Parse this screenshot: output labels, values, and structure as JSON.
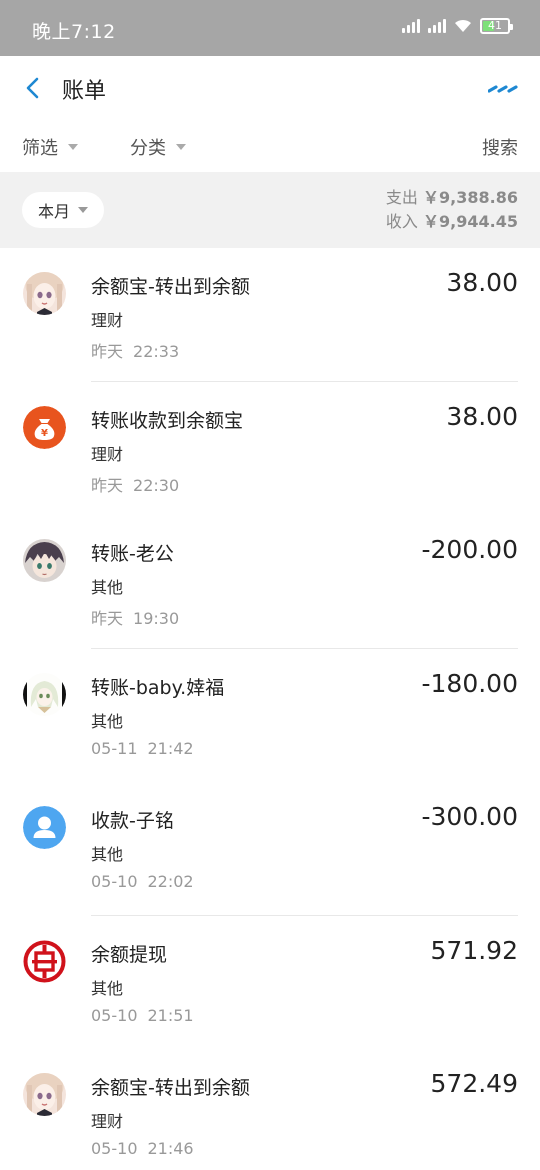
{
  "status_bar": {
    "time": "晚上7:12",
    "battery": "41"
  },
  "header": {
    "title": "账单"
  },
  "filters": {
    "screen": "筛选",
    "category": "分类",
    "search": "搜索"
  },
  "summary": {
    "month": "本月",
    "expense_label": "支出",
    "expense_amount": "￥9,388.86",
    "income_label": "收入",
    "income_amount": "￥9,944.45"
  },
  "transactions": [
    {
      "title": "余额宝-转出到余额",
      "category": "理财",
      "date": "昨天",
      "time": "22:33",
      "amount": "38.00",
      "avatar": "doll-avatar"
    },
    {
      "title": "转账收款到余额宝",
      "category": "理财",
      "date": "昨天",
      "time": "22:30",
      "amount": "38.00",
      "avatar": "money-bag-icon"
    },
    {
      "title": "转账-老公",
      "category": "其他",
      "date": "昨天",
      "time": "19:30",
      "amount": "-200.00",
      "avatar": "anime-boy-avatar"
    },
    {
      "title": "转账-baby.婞福",
      "category": "其他",
      "date": "05-11",
      "time": "21:42",
      "amount": "-180.00",
      "avatar": "anime-girl-avatar"
    },
    {
      "title": "收款-子铭",
      "category": "其他",
      "date": "05-10",
      "time": "22:02",
      "amount": "-300.00",
      "avatar": "default-user-icon"
    },
    {
      "title": "余额提现",
      "category": "其他",
      "date": "05-10",
      "time": "21:51",
      "amount": "571.92",
      "avatar": "bank-logo-icon"
    },
    {
      "title": "余额宝-转出到余额",
      "category": "理财",
      "date": "05-10",
      "time": "21:46",
      "amount": "572.49",
      "avatar": "doll-avatar"
    }
  ],
  "colors": {
    "accent": "#1e88d2",
    "status_bar": "#a6a6a6",
    "summary_bg": "#f1f1f1",
    "money_bag": "#e8541e",
    "user_icon": "#4ea6f0",
    "bank_red": "#d0121b"
  }
}
